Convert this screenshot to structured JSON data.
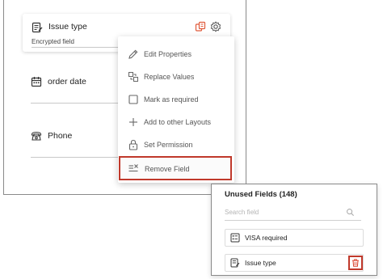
{
  "layout_canvas": {
    "selected_field": {
      "name": "Issue type",
      "subtitle": "Encrypted field",
      "icons": [
        "text-field-icon",
        "shared-fields-icon",
        "gear-icon"
      ]
    },
    "fields": [
      {
        "name": "order date",
        "icon": "calendar-icon"
      },
      {
        "name": "Phone",
        "icon": "phone-icon"
      }
    ]
  },
  "field_menu": {
    "items": [
      {
        "label": "Edit Properties",
        "icon": "pencil-icon"
      },
      {
        "label": "Replace Values",
        "icon": "replace-icon"
      },
      {
        "label": "Mark as required",
        "icon": "checkbox-icon"
      },
      {
        "label": "Add to other Layouts",
        "icon": "plus-icon"
      },
      {
        "label": "Set Permission",
        "icon": "lock-icon"
      },
      {
        "label": "Remove Field",
        "icon": "remove-field-icon",
        "highlighted": true
      }
    ]
  },
  "unused_fields": {
    "title": "Unused Fields",
    "count": "(148)",
    "search_placeholder": "Search field",
    "items": [
      {
        "label": "VISA required",
        "icon": "checklist-icon"
      },
      {
        "label": "Issue type",
        "icon": "text-field-icon",
        "action_icon": "trash-icon"
      }
    ]
  },
  "colors": {
    "highlight_border": "#c0392b",
    "shared_icon": "#e05a3a",
    "trash_icon": "#d9412b"
  }
}
